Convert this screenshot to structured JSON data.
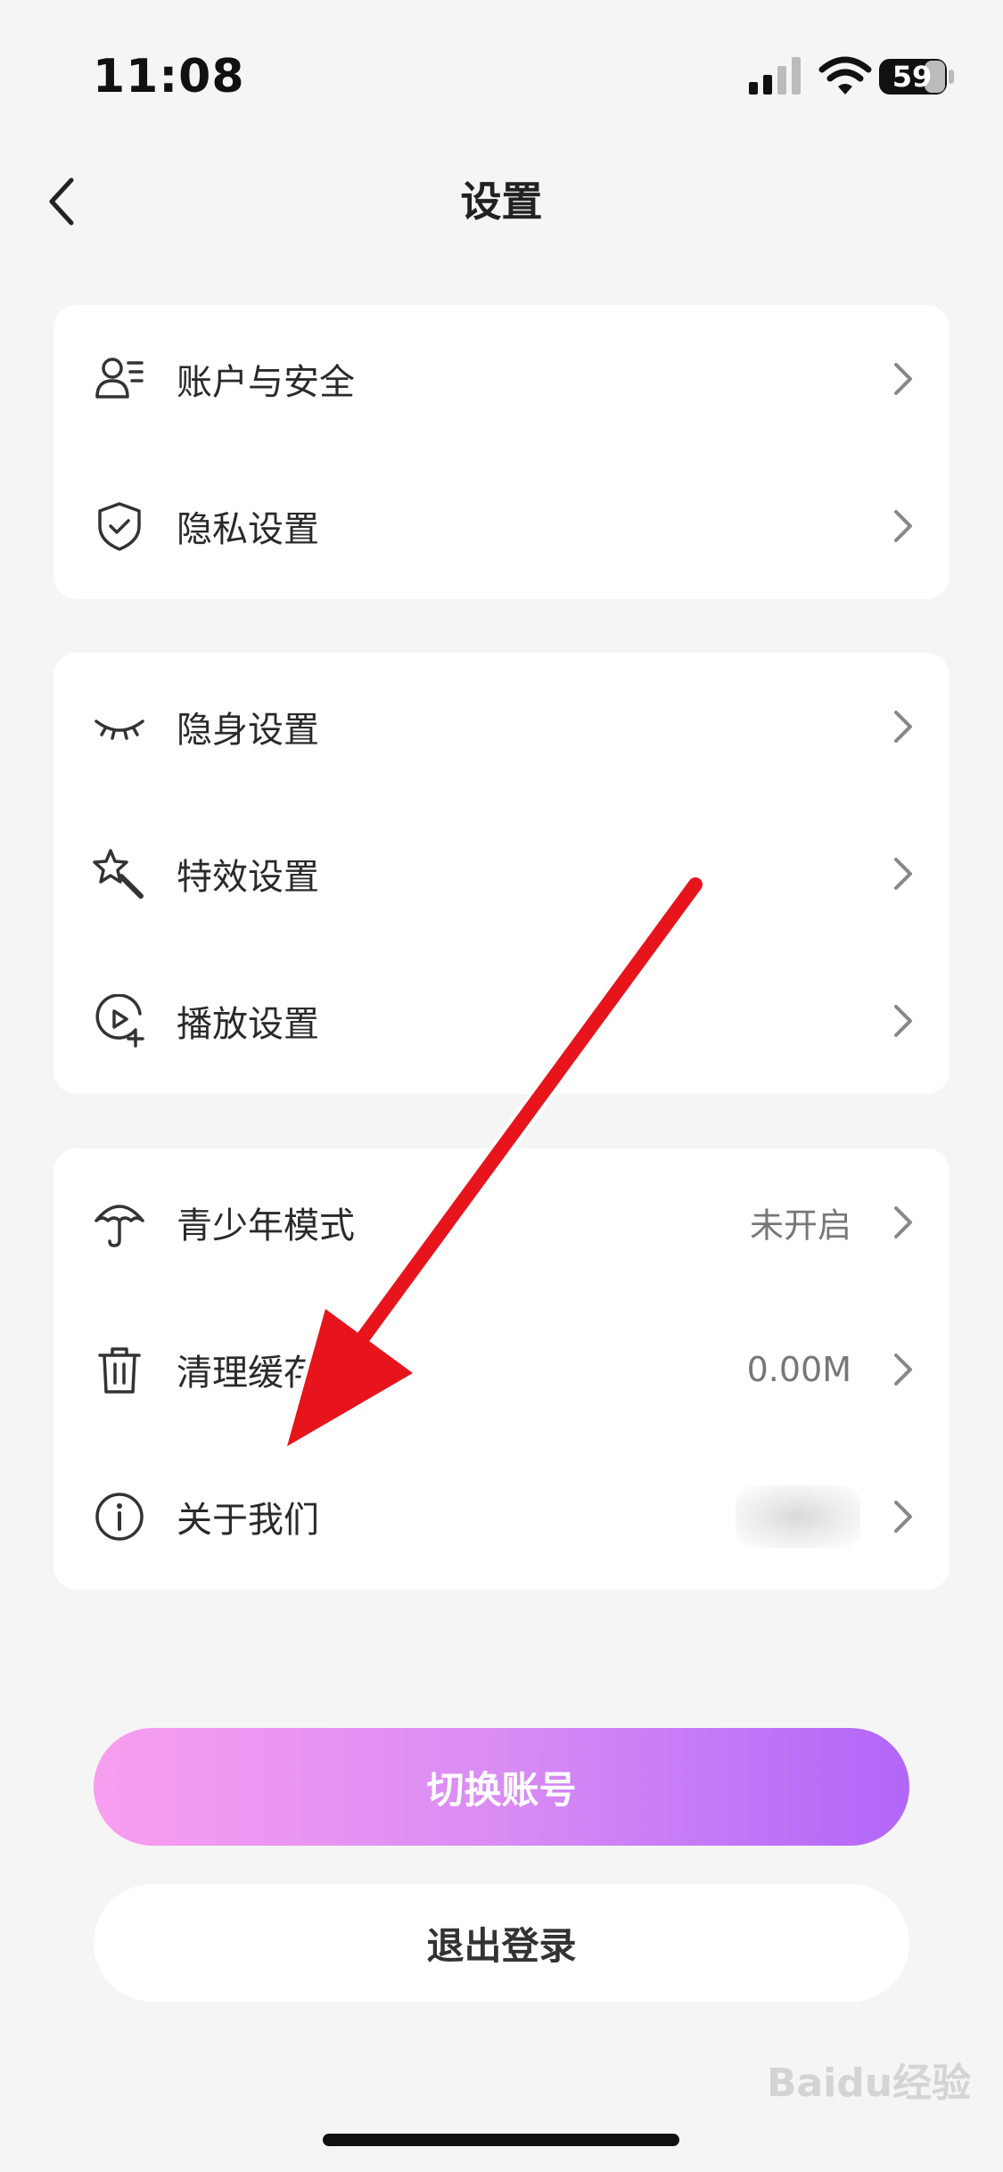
{
  "status_bar": {
    "time": "11:08",
    "battery": "59"
  },
  "nav": {
    "title": "设置"
  },
  "groups": [
    {
      "items": [
        {
          "label": "账户与安全",
          "icon": "account-security-icon"
        },
        {
          "label": "隐私设置",
          "icon": "shield-check-icon"
        }
      ]
    },
    {
      "items": [
        {
          "label": "隐身设置",
          "icon": "closed-eye-icon"
        },
        {
          "label": "特效设置",
          "icon": "magic-wand-icon"
        },
        {
          "label": "播放设置",
          "icon": "play-plus-icon"
        }
      ]
    },
    {
      "items": [
        {
          "label": "青少年模式",
          "icon": "umbrella-icon",
          "value": "未开启"
        },
        {
          "label": "清理缓存",
          "icon": "trash-icon",
          "value": "0.00M"
        },
        {
          "label": "关于我们",
          "icon": "info-icon"
        }
      ]
    }
  ],
  "buttons": {
    "switch_account": "切换账号",
    "logout": "退出登录"
  },
  "watermark": "Baidu经验",
  "colors": {
    "gradient_start": "#f99ef0",
    "gradient_end": "#b266f8",
    "annotation_arrow": "#e8141c"
  }
}
